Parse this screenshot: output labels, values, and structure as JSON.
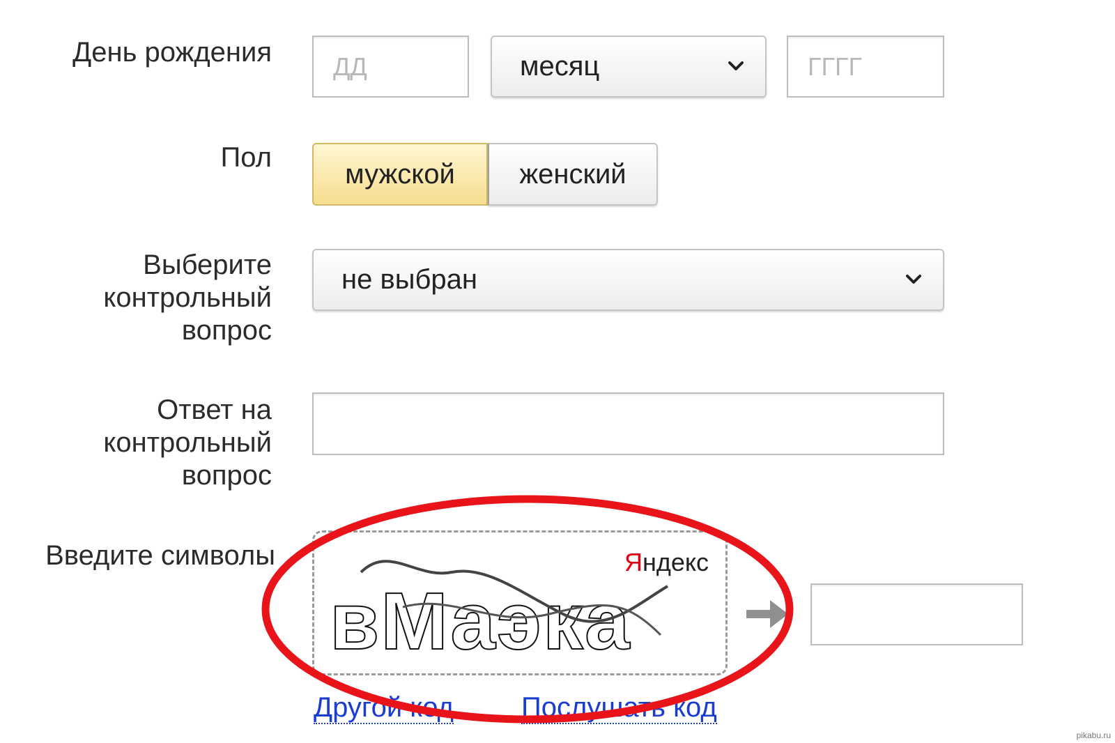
{
  "form": {
    "birthday": {
      "label": "День рождения",
      "day_placeholder": "ДД",
      "month_value": "месяц",
      "year_placeholder": "ГГГГ"
    },
    "gender": {
      "label": "Пол",
      "options": [
        "мужской",
        "женский"
      ],
      "selected": "мужской"
    },
    "security_question": {
      "label": "Выберите\nконтрольный\nвопрос",
      "value": "не выбран"
    },
    "security_answer": {
      "label": "Ответ на\nконтрольный\nвопрос",
      "value": ""
    },
    "captcha": {
      "label": "Введите символы",
      "brand": "Яндекс",
      "brand_first": "Я",
      "brand_rest": "ндекс",
      "image_text": "вМаэка",
      "other_code": "Другой код",
      "listen_code": "Послушать код",
      "input_value": ""
    }
  },
  "annotation": {
    "highlight_color": "#e8141a"
  },
  "watermark": "pikabu.ru"
}
